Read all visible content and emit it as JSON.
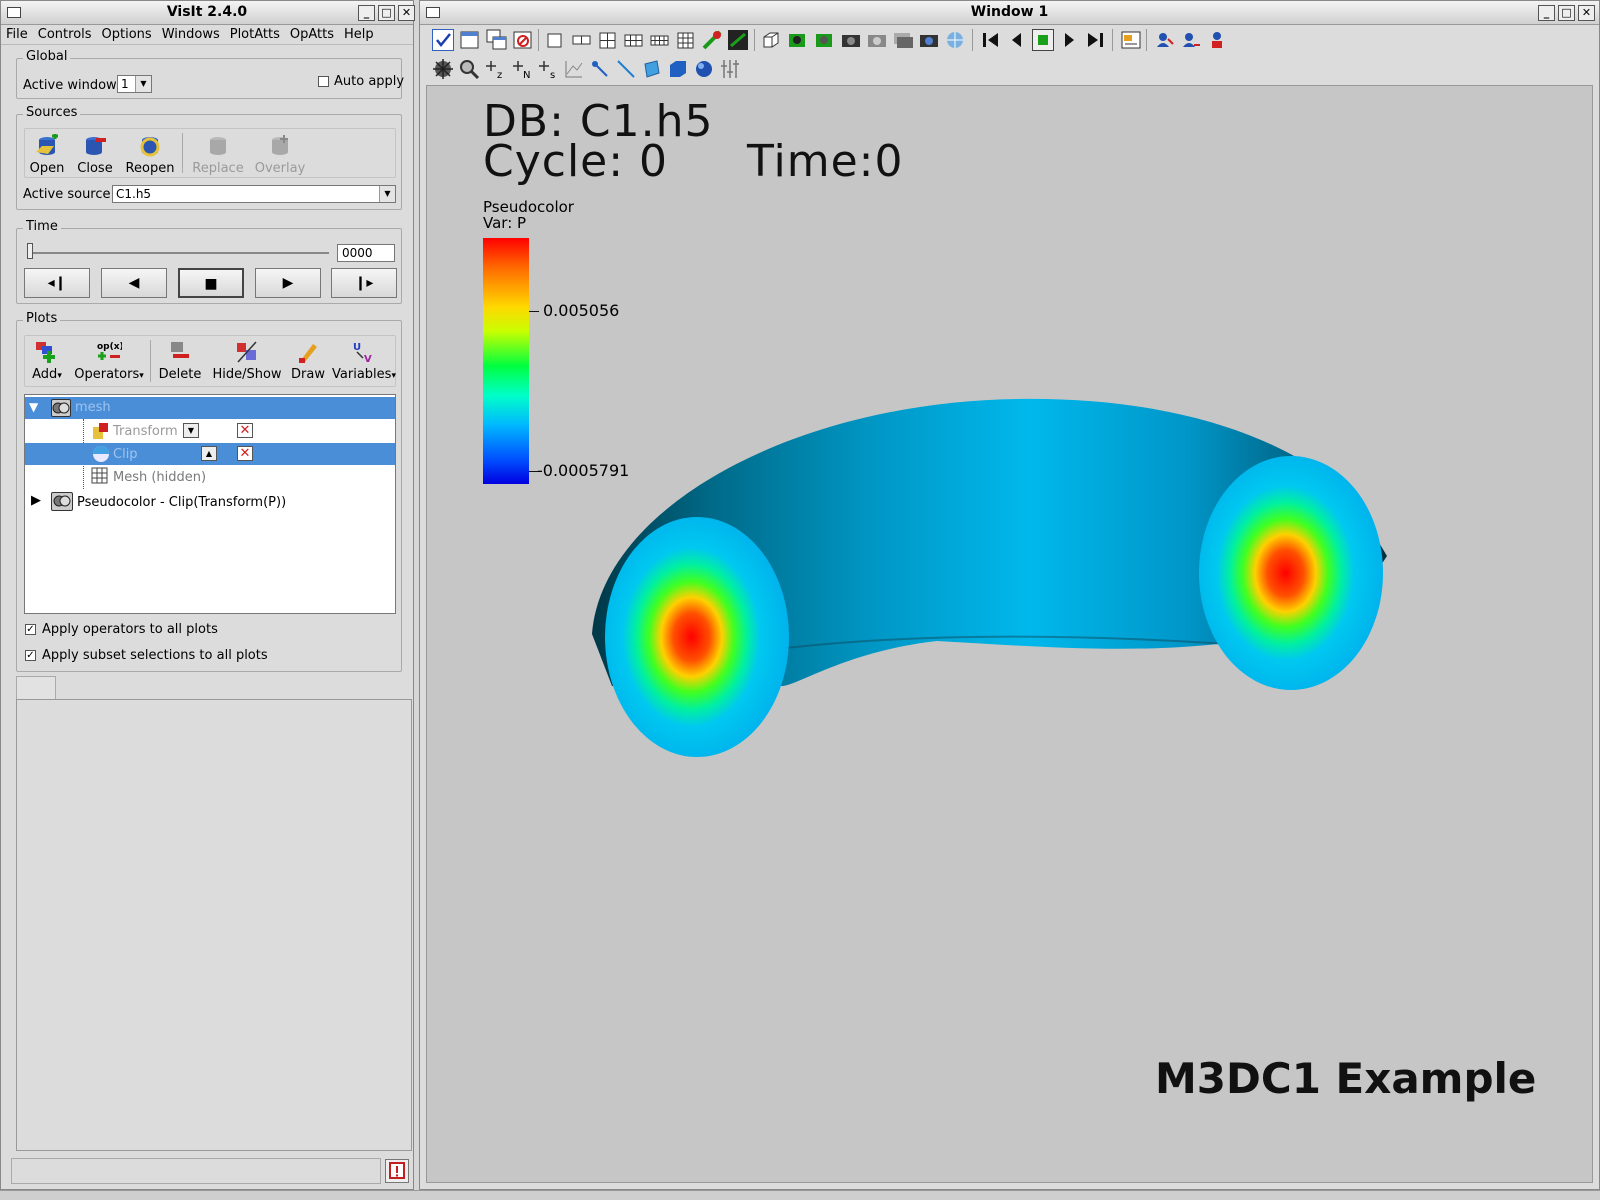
{
  "left_window": {
    "title": "VisIt 2.4.0",
    "menu": [
      "File",
      "Controls",
      "Options",
      "Windows",
      "PlotAtts",
      "OpAtts",
      "Help"
    ],
    "global": {
      "label": "Global",
      "active_window_label": "Active window",
      "active_window_value": "1",
      "auto_apply_label": "Auto apply",
      "auto_apply_checked": false
    },
    "sources": {
      "label": "Sources",
      "buttons": {
        "open": "Open",
        "close": "Close",
        "reopen": "Reopen",
        "replace": "Replace",
        "overlay": "Overlay"
      },
      "active_source_label": "Active source",
      "active_source_value": "C1.h5"
    },
    "time": {
      "label": "Time",
      "slider_value": 0,
      "state_value": "0000",
      "controls": {
        "step_back": "◂❙",
        "reverse": "◀",
        "stop": "■",
        "play": "▶",
        "step_forward": "❙▸"
      }
    },
    "plots": {
      "label": "Plots",
      "buttons": {
        "add": "Add",
        "operators": "Operators",
        "delete": "Delete",
        "hide_show": "Hide/Show",
        "draw": "Draw",
        "variables": "Variables"
      },
      "tree": {
        "mesh": "mesh",
        "transform": "Transform",
        "clip": "Clip",
        "mesh_hidden": "Mesh (hidden)",
        "pseudocolor": "Pseudocolor - Clip(Transform(P))"
      },
      "apply_operators_label": "Apply operators to all plots",
      "apply_operators_checked": true,
      "apply_subset_label": "Apply subset selections to all plots",
      "apply_subset_checked": true
    }
  },
  "right_window": {
    "title": "Window 1",
    "annotations": {
      "db": "DB: C1.h5",
      "cycle": "Cycle: 0",
      "time": "Time:0",
      "footer": "M3DC1 Example"
    },
    "legend": {
      "title": "Pseudocolor",
      "var": "Var: P",
      "max_label": "0.005056",
      "min_label": "-0.0005791"
    }
  },
  "colors": {
    "selection": "#4b8ed8",
    "viewport_bg": "#c6c6c6",
    "torus_body": "#00b4e8"
  }
}
